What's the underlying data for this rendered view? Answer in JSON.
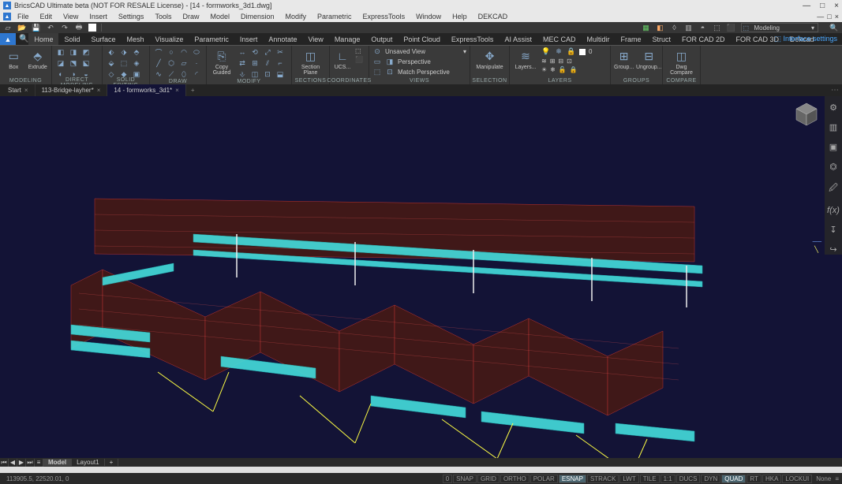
{
  "title": "BricsCAD Ultimate beta (NOT FOR RESALE License) - [14 - formworks_3d1.dwg]",
  "app_icon_letter": "▲",
  "menus": [
    "File",
    "Edit",
    "View",
    "Insert",
    "Settings",
    "Tools",
    "Draw",
    "Model",
    "Dimension",
    "Modify",
    "Parametric",
    "ExpressTools",
    "Window",
    "Help",
    "DEKCAD"
  ],
  "menu_right": [
    "—",
    "□",
    "×"
  ],
  "win_controls": [
    "—",
    "□",
    "×"
  ],
  "qat_workspace": "Modeling",
  "ribbon_tabs": [
    "Home",
    "Solid",
    "Surface",
    "Mesh",
    "Visualize",
    "Parametric",
    "Insert",
    "Annotate",
    "View",
    "Manage",
    "Output",
    "Point Cloud",
    "ExpressTools",
    "AI Assist",
    "MEC CAD",
    "Multidir",
    "Frame",
    "Struct",
    "FOR CAD 2D",
    "FOR CAD 3D",
    "Dekcad"
  ],
  "ribbon_active_tab": "Home",
  "interface_settings": "Interface settings",
  "panels": {
    "modeling": {
      "label": "MODELING",
      "box": "Box",
      "extrude": "Extrude"
    },
    "direct_modeling": "DIRECT MODELING",
    "solid_editing": "SOLID EDITING",
    "draw": "DRAW",
    "modify": {
      "label": "MODIFY",
      "copy_guided": "Copy Guided"
    },
    "sections": {
      "label": "SECTIONS",
      "section_plane": "Section Plane"
    },
    "coordinates": {
      "label": "COORDINATES",
      "ucs": "UCS..."
    },
    "views": {
      "label": "VIEWS",
      "unsaved_view": "Unsaved View",
      "perspective": "Perspective",
      "match_perspective": "Match Perspective"
    },
    "selection": {
      "label": "SELECTION",
      "manipulate": "Manipulate"
    },
    "layers": {
      "label": "LAYERS",
      "layers_btn": "Layers...",
      "zero": "0"
    },
    "groups": {
      "label": "GROUPS",
      "group": "Group...",
      "ungroup": "Ungroup..."
    },
    "compare": {
      "label": "COMPARE",
      "dwg_compare": "Dwg Compare"
    }
  },
  "doc_tabs": [
    {
      "label": "Start",
      "active": false
    },
    {
      "label": "113-Bridge-layher*",
      "active": false
    },
    {
      "label": "14 - formworks_3d1*",
      "active": true
    }
  ],
  "layout_tabs": {
    "model": "Model",
    "layout1": "Layout1"
  },
  "status": {
    "coords": "113905.5, 22520.01, 0",
    "zero": "0",
    "buttons": [
      "SNAP",
      "GRID",
      "ORTHO",
      "POLAR",
      "ESNAP",
      "STRACK",
      "LWT",
      "TILE",
      "1:1",
      "DUCS",
      "DYN",
      "QUAD",
      "RT",
      "HKA",
      "LOCKUI"
    ],
    "on": [
      "ESNAP",
      "QUAD"
    ],
    "none": "None"
  },
  "sidebar_icons": [
    "⚙",
    "▥",
    "▣",
    "⏣",
    "🖉",
    "f(x)",
    "↧",
    "↪"
  ]
}
